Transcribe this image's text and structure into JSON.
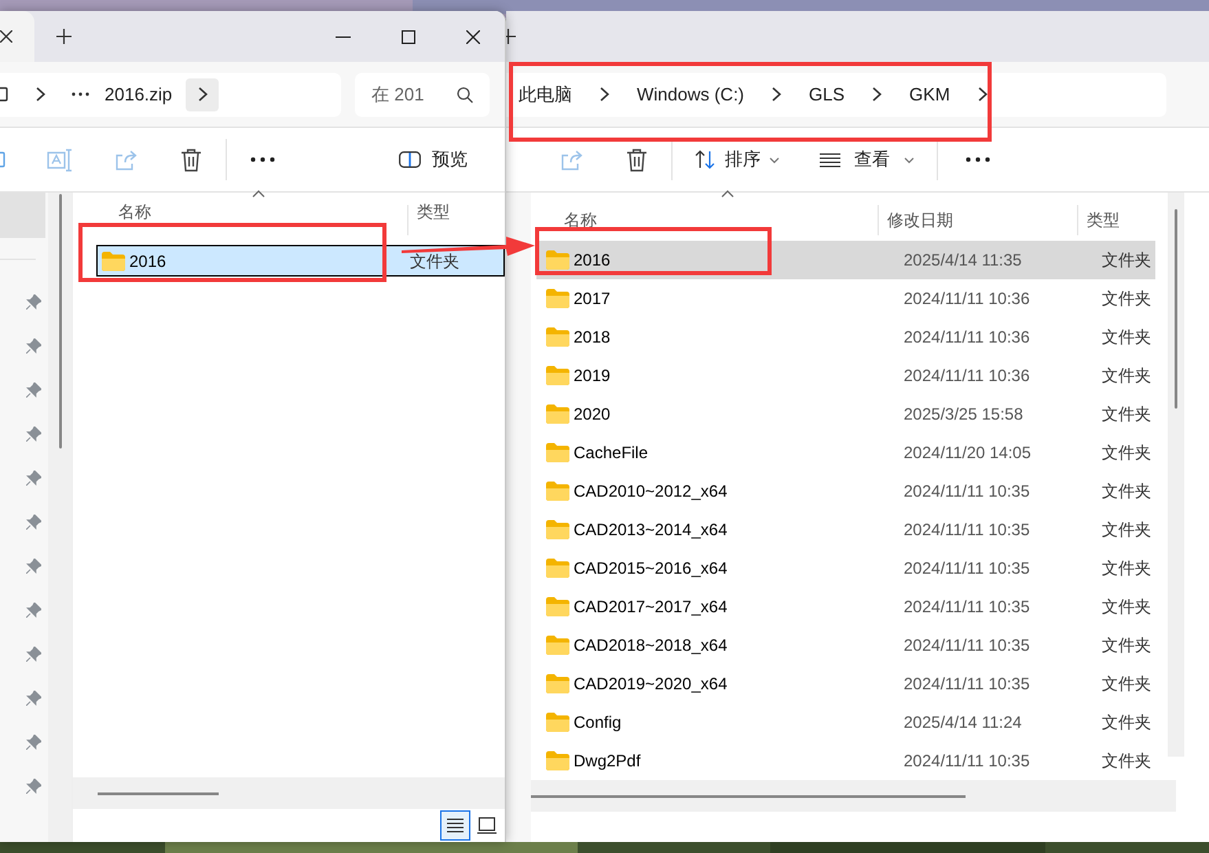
{
  "left_window": {
    "address": {
      "path": "2016.zip"
    },
    "search": {
      "placeholder": "在 201"
    },
    "toolbar": {
      "preview": "预览"
    },
    "columns": [
      "名称",
      "类型"
    ],
    "rows": [
      {
        "name": "2016",
        "type": "文件夹",
        "selected": true
      }
    ],
    "view_buttons": [
      {
        "kind": "details",
        "selected": true
      },
      {
        "kind": "tiles",
        "selected": false
      }
    ]
  },
  "right_window": {
    "breadcrumb": [
      "此电脑",
      "Windows (C:)",
      "GLS",
      "GKM"
    ],
    "toolbar": {
      "sort": "排序",
      "view": "查看"
    },
    "columns": [
      "名称",
      "修改日期",
      "类型"
    ],
    "rows": [
      {
        "name": "2016",
        "date": "2025/4/14 11:35",
        "type": "文件夹",
        "selected": true
      },
      {
        "name": "2017",
        "date": "2024/11/11 10:36",
        "type": "文件夹",
        "selected": false
      },
      {
        "name": "2018",
        "date": "2024/11/11 10:36",
        "type": "文件夹",
        "selected": false
      },
      {
        "name": "2019",
        "date": "2024/11/11 10:36",
        "type": "文件夹",
        "selected": false
      },
      {
        "name": "2020",
        "date": "2025/3/25 15:58",
        "type": "文件夹",
        "selected": false
      },
      {
        "name": "CacheFile",
        "date": "2024/11/20 14:05",
        "type": "文件夹",
        "selected": false
      },
      {
        "name": "CAD2010~2012_x64",
        "date": "2024/11/11 10:35",
        "type": "文件夹",
        "selected": false
      },
      {
        "name": "CAD2013~2014_x64",
        "date": "2024/11/11 10:35",
        "type": "文件夹",
        "selected": false
      },
      {
        "name": "CAD2015~2016_x64",
        "date": "2024/11/11 10:35",
        "type": "文件夹",
        "selected": false
      },
      {
        "name": "CAD2017~2017_x64",
        "date": "2024/11/11 10:35",
        "type": "文件夹",
        "selected": false
      },
      {
        "name": "CAD2018~2018_x64",
        "date": "2024/11/11 10:35",
        "type": "文件夹",
        "selected": false
      },
      {
        "name": "CAD2019~2020_x64",
        "date": "2024/11/11 10:35",
        "type": "文件夹",
        "selected": false
      },
      {
        "name": "Config",
        "date": "2025/4/14 11:24",
        "type": "文件夹",
        "selected": false
      },
      {
        "name": "Dwg2Pdf",
        "date": "2024/11/11 10:35",
        "type": "文件夹",
        "selected": false
      }
    ]
  }
}
